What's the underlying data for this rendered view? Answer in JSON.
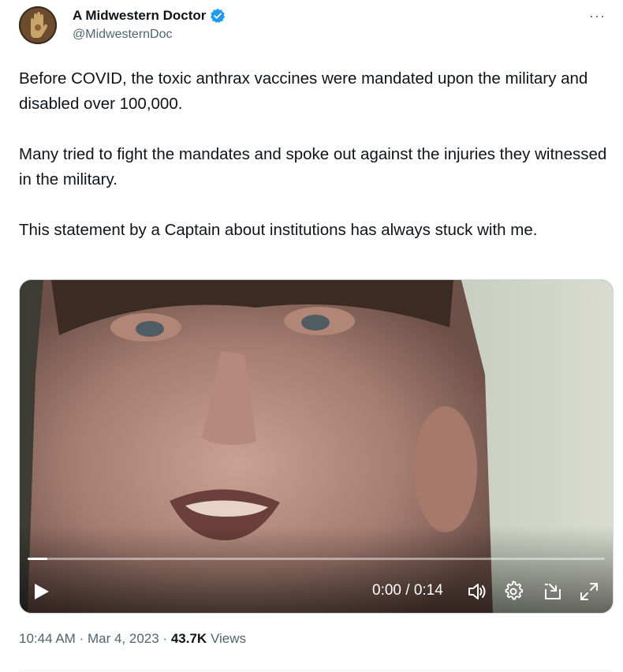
{
  "author": {
    "display_name": "A Midwestern Doctor",
    "handle": "@MidwesternDoc",
    "verified": true,
    "verified_color": "#1d9bf0"
  },
  "more_label": "···",
  "tweet": {
    "paragraphs": [
      "Before COVID, the toxic anthrax vaccines were mandated upon the military and disabled over 100,000.",
      "Many tried to fight the mandates and spoke out  against the injuries they witnessed in the military.",
      "This statement by a Captain about institutions has always stuck with me."
    ]
  },
  "video": {
    "timecode": "0:00 / 0:14",
    "progress": 0.034,
    "controls": [
      "play-icon",
      "volume-icon",
      "settings-icon",
      "pip-icon",
      "fullscreen-icon"
    ]
  },
  "footer": {
    "time": "10:44 AM",
    "date": "Mar 4, 2023",
    "dot": "·",
    "views_count": "43.7K",
    "views_label": "Views"
  }
}
